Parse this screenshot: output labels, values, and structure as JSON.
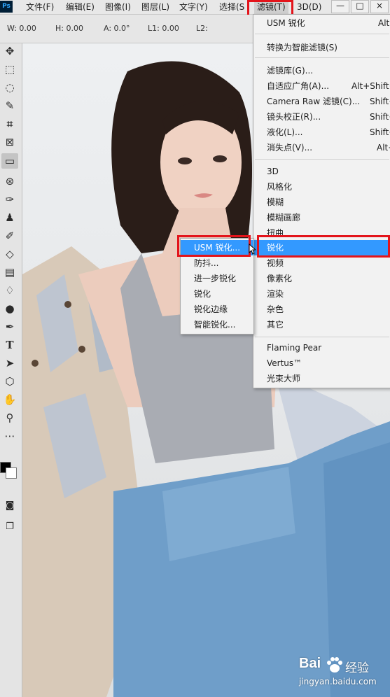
{
  "app": {
    "logo": "Ps"
  },
  "menubar": {
    "items": [
      "文件(F)",
      "编辑(E)",
      "图像(I)",
      "图层(L)",
      "文字(Y)",
      "选择(S",
      "滤镜(T)",
      "3D(D)"
    ],
    "window_controls": [
      "—",
      "□",
      "×"
    ]
  },
  "options": {
    "w": "W: 0.00",
    "h": "H: 0.00",
    "a": "A: 0.0°",
    "l1": "L1: 0.00",
    "l2": "L2:"
  },
  "toolbar": {
    "selected_tool": "ruler-tool",
    "tools": [
      "move",
      "marquee",
      "lasso",
      "quick-select",
      "crop",
      "frame",
      "ruler",
      "spot-heal",
      "brush",
      "stamp",
      "history-brush",
      "eraser",
      "gradient",
      "blur",
      "dodge",
      "pen",
      "type",
      "path-select",
      "shape",
      "hand",
      "zoom",
      "more"
    ],
    "foreground_color": "#000000",
    "background_color": "#ffffff"
  },
  "filter_menu": {
    "last_filter": {
      "label": "USM 锐化",
      "shortcut": "Alt"
    },
    "convert": "转换为智能滤镜(S)",
    "group1": [
      {
        "label": "滤镜库(G)...",
        "shortcut": ""
      },
      {
        "label": "自适应广角(A)...",
        "shortcut": "Alt+Shift+"
      },
      {
        "label": "Camera Raw 滤镜(C)...",
        "shortcut": "Shift+"
      },
      {
        "label": "镜头校正(R)...",
        "shortcut": "Shift+"
      },
      {
        "label": "液化(L)...",
        "shortcut": "Shift+"
      },
      {
        "label": "消失点(V)...",
        "shortcut": "Alt+"
      }
    ],
    "group2": [
      "3D",
      "风格化",
      "模糊",
      "模糊画廊",
      "扭曲",
      "锐化",
      "视频",
      "像素化",
      "渲染",
      "杂色",
      "其它"
    ],
    "highlighted": "锐化",
    "group3": [
      "Flaming Pear",
      "Vertus™",
      "光束大师"
    ]
  },
  "sharpen_submenu": {
    "items": [
      "USM 锐化...",
      "防抖...",
      "进一步锐化",
      "锐化",
      "锐化边缘",
      "智能锐化..."
    ],
    "highlighted": "USM 锐化..."
  },
  "watermark": {
    "brand": "Bai",
    "brand2": "经验",
    "url": "jingyan.baidu.com"
  }
}
